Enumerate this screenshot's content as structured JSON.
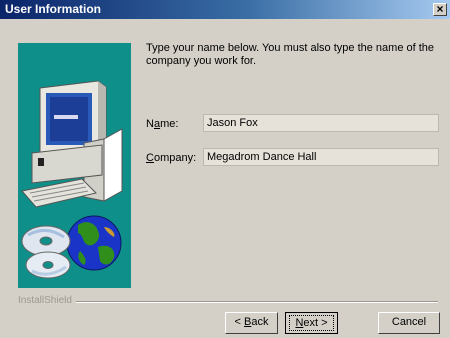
{
  "window": {
    "title": "User Information"
  },
  "instruction": "Type your name below. You must also type the name of the company you work for.",
  "form": {
    "name_label_pre": "N",
    "name_label_ul": "a",
    "name_label_post": "me:",
    "name_value": "Jason Fox",
    "company_label_ul": "C",
    "company_label_post": "ompany:",
    "company_value": "Megadrom Dance Hall"
  },
  "footer": {
    "brand": "InstallShield"
  },
  "buttons": {
    "back_pre": "< ",
    "back_ul": "B",
    "back_post": "ack",
    "next_ul": "N",
    "next_post": "ext >",
    "cancel": "Cancel"
  },
  "colors": {
    "title_gradient_start": "#0a246a",
    "graphic_background": "#0f8f8a",
    "dialog_face": "#d4d0c8"
  },
  "icons": [
    "close-icon",
    "computer-icon",
    "globe-icon",
    "cd-icon"
  ]
}
